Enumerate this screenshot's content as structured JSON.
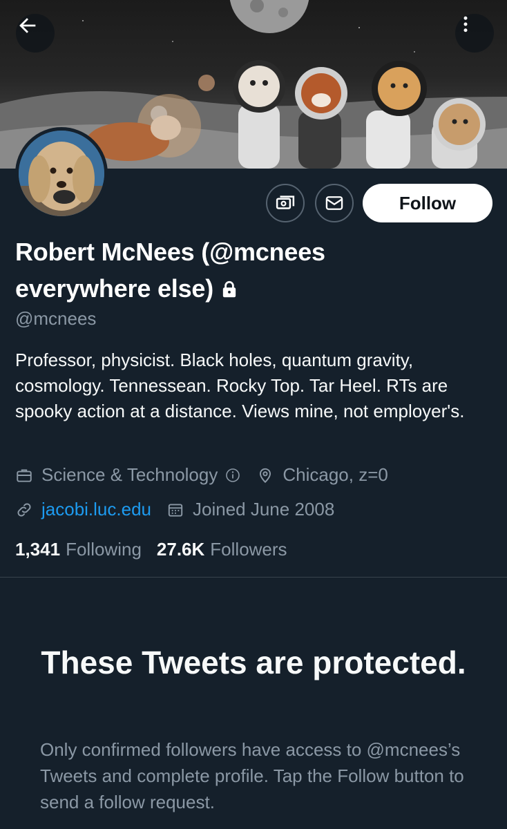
{
  "banner": {
    "back_icon": "arrow-left-icon",
    "more_icon": "more-vertical-icon"
  },
  "actions": {
    "tip_icon": "tip-jar-icon",
    "message_icon": "mail-icon",
    "follow_label": "Follow"
  },
  "profile": {
    "name": "Robert McNees (@mcnees everywhere else)",
    "protected_icon": "lock-icon",
    "handle": "@mcnees",
    "bio": "Professor, physicist. Black holes, quantum gravity, cosmology. Tennessean. Rocky Top. Tar Heel. RTs are spooky action at a distance. Views mine, not employer's.",
    "category": "Science & Technology",
    "location": "Chicago, z=0",
    "website": "jacobi.luc.edu",
    "joined": "Joined June 2008",
    "following_count": "1,341",
    "following_label": "Following",
    "followers_count": "27.6K",
    "followers_label": "Followers"
  },
  "protected_notice": {
    "title": "These Tweets are protected.",
    "body": "Only confirmed followers have access to @mcnees’s Tweets and complete profile. Tap the Follow button to send a follow request."
  },
  "colors": {
    "background": "#15202b",
    "text_secondary": "#8b98a5",
    "link": "#1d9bf0",
    "follow_button_bg": "#ffffff",
    "border": "#38444d"
  }
}
